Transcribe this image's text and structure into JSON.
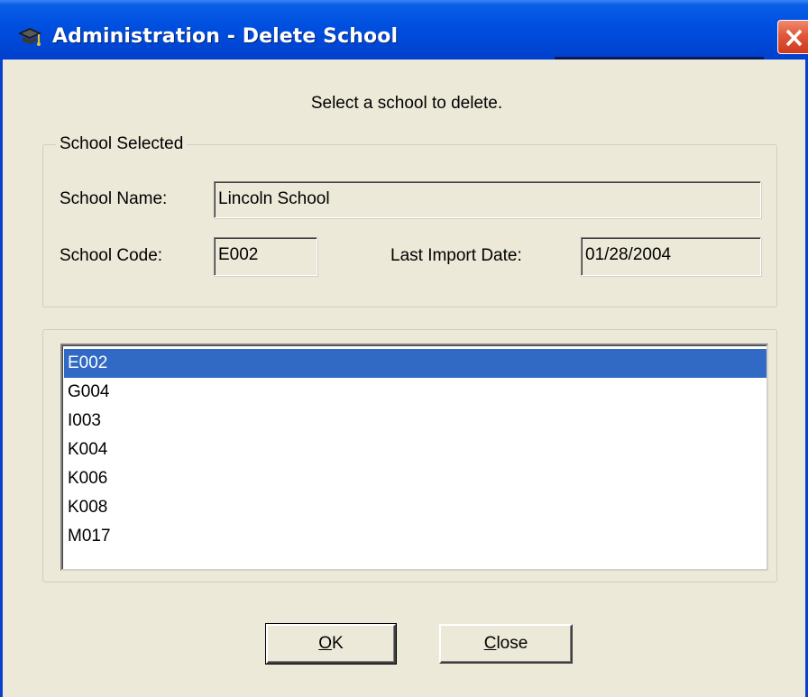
{
  "window": {
    "title": "Administration - Delete School",
    "title_icon": "graduation-cap-icon",
    "close_icon": "close-icon",
    "title_color": "#0050e0",
    "close_color": "#e0573a"
  },
  "prompt": "Select a school to delete.",
  "school_selected": {
    "legend": "School Selected",
    "name_label": "School Name:",
    "name_value": "Lincoln School",
    "code_label": "School Code:",
    "code_value": "E002",
    "import_label": "Last Import Date:",
    "import_value": "01/28/2004"
  },
  "school_list": {
    "items": [
      "E002",
      "G004",
      "I003",
      "K004",
      "K006",
      "K008",
      "M017"
    ],
    "selected": "E002",
    "selection_color": "#316ac5"
  },
  "buttons": {
    "ok_mnemonic": "O",
    "ok_rest": "K",
    "close_mnemonic": "C",
    "close_rest": "lose"
  }
}
